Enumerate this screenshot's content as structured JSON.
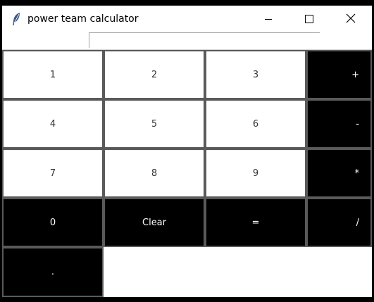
{
  "window": {
    "title": "power team calculator",
    "controls": {
      "minimize_icon": "minimize-icon",
      "maximize_icon": "maximize-icon",
      "close_icon": "close-icon"
    }
  },
  "display": {
    "value": ""
  },
  "keys": {
    "k1": "1",
    "k2": "2",
    "k3": "3",
    "plus": "+",
    "k4": "4",
    "k5": "5",
    "k6": "6",
    "minus": "-",
    "k7": "7",
    "k8": "8",
    "k9": "9",
    "multiply": "*",
    "k0": "0",
    "clear": "Clear",
    "equals": "=",
    "divide": "/",
    "dot": "."
  },
  "colors": {
    "digit_key_bg": "#ffffff",
    "operator_key_bg": "#000000",
    "operator_key_text": "#ffffff",
    "key_border": "#5a5a5a"
  }
}
